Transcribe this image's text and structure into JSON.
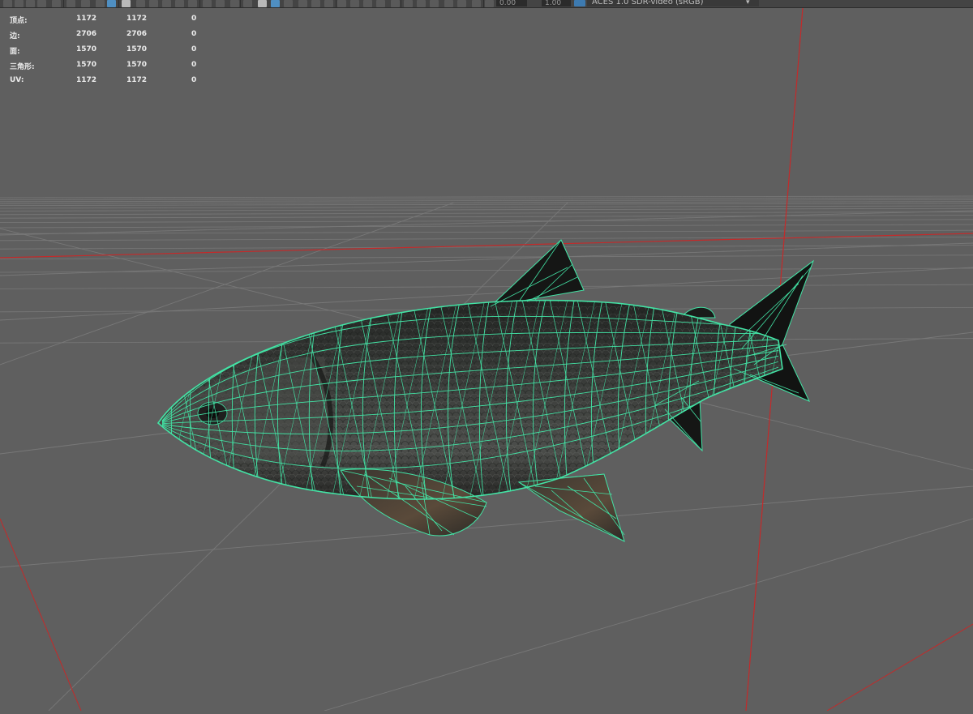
{
  "toolbar": {
    "field_1": "0.00",
    "field_2": "1.00",
    "color_space": "ACES 1.0 SDR-video (sRGB)"
  },
  "hud": {
    "rows": [
      {
        "label": "顶点:",
        "a": "1172",
        "b": "1172",
        "c": "0"
      },
      {
        "label": "边:",
        "a": "2706",
        "b": "2706",
        "c": "0"
      },
      {
        "label": "面:",
        "a": "1570",
        "b": "1570",
        "c": "0"
      },
      {
        "label": "三角形:",
        "a": "1570",
        "b": "1570",
        "c": "0"
      },
      {
        "label": "UV:",
        "a": "1172",
        "b": "1172",
        "c": "0"
      }
    ]
  },
  "colors": {
    "viewport_bg": "#5f5f5f",
    "grid": "#787878",
    "axis": "#c42a2a",
    "wireframe": "#43e3a5",
    "mesh_fill": "#2e302e"
  },
  "icons": [
    "selection-icon",
    "lasso-icon",
    "paint-icon",
    "snap-icon",
    "camera-icon",
    "grid-icon",
    "shading-icon",
    "texture-icon",
    "light-icon",
    "xray-icon",
    "color-space-icon"
  ]
}
